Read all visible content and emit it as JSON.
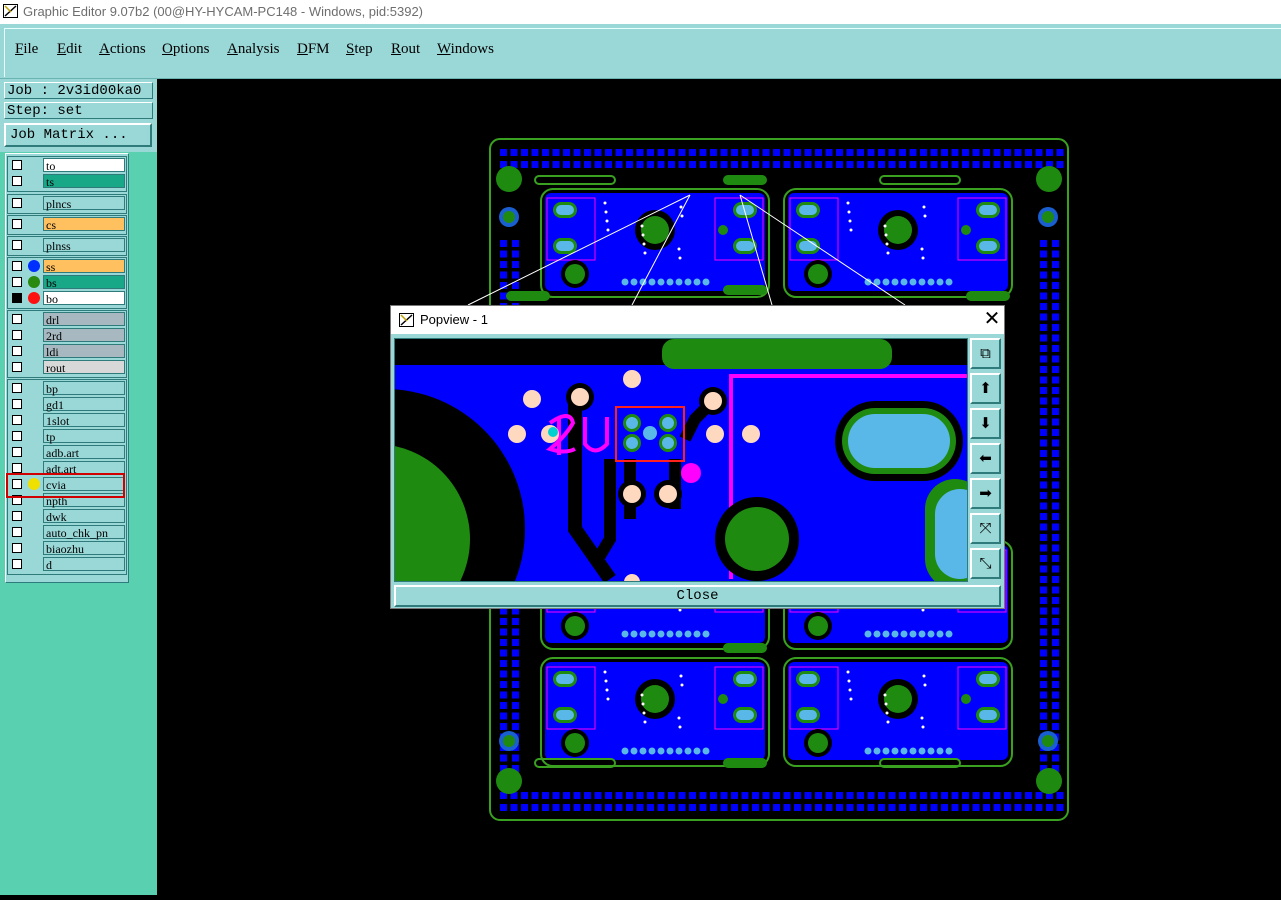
{
  "window": {
    "title": "Graphic Editor 9.07b2 (00@HY-HYCAM-PC148 - Windows, pid:5392)"
  },
  "menu": {
    "items": [
      {
        "label": "File"
      },
      {
        "label": "Edit"
      },
      {
        "label": "Actions"
      },
      {
        "label": "Options"
      },
      {
        "label": "Analysis"
      },
      {
        "label": "DFM"
      },
      {
        "label": "Step"
      },
      {
        "label": "Rout"
      },
      {
        "label": "Windows"
      }
    ]
  },
  "job": {
    "job_label": "Job : 2v3id00ka0",
    "step_label": "Step: set",
    "matrix_button": "Job Matrix ..."
  },
  "layers": [
    {
      "name": "to",
      "color": "#ffffff"
    },
    {
      "name": "ts",
      "color": "#18a888"
    },
    {
      "name": "plncs",
      "color": "#9ad7d7"
    },
    {
      "name": "cs",
      "color": "#ffc060"
    },
    {
      "name": "plnss",
      "color": "#9ad7d7"
    },
    {
      "name": "ss",
      "color": "#ffc060",
      "dot": "#0030ff"
    },
    {
      "name": "bs",
      "color": "#18a888",
      "dot": "#2a8a10"
    },
    {
      "name": "bo",
      "color": "#ffffff",
      "dot": "#ff1010"
    },
    {
      "name": "drl",
      "color": "#a8b8c0"
    },
    {
      "name": "2rd",
      "color": "#a8b8c0"
    },
    {
      "name": "ldi",
      "color": "#a8b8c0"
    },
    {
      "name": "rout",
      "color": "#d8d8d8"
    },
    {
      "name": "bp",
      "color": "#9ad7d7"
    },
    {
      "name": "gd1",
      "color": "#9ad7d7"
    },
    {
      "name": "1slot",
      "color": "#9ad7d7"
    },
    {
      "name": "tp",
      "color": "#9ad7d7"
    },
    {
      "name": "adb.art",
      "color": "#9ad7d7"
    },
    {
      "name": "adt.art",
      "color": "#9ad7d7"
    },
    {
      "name": "cvia",
      "color": "#9ad7d7",
      "dot": "#f0e000"
    },
    {
      "name": "npth",
      "color": "#9ad7d7"
    },
    {
      "name": "dwk",
      "color": "#9ad7d7"
    },
    {
      "name": "auto_chk_pn",
      "color": "#9ad7d7"
    },
    {
      "name": "biaozhu",
      "color": "#9ad7d7"
    },
    {
      "name": "d",
      "color": "#9ad7d7"
    }
  ],
  "popview": {
    "title": "Popview - 1",
    "close_label": "Close"
  },
  "colors": {
    "copper_blue": "#0000ff",
    "pad_green": "#1f8a10",
    "outline_green": "#3aa020",
    "pad_light": "#5ab8e8",
    "silkscreen_magenta": "#ff00ff",
    "panel_teal": "#9ad7d7"
  }
}
